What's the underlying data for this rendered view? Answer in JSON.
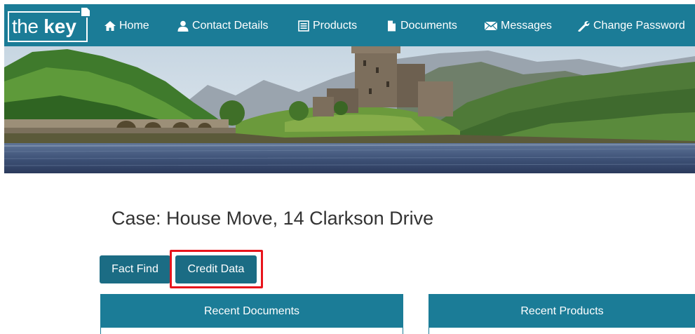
{
  "logo": {
    "word1": "the",
    "word2": "key"
  },
  "nav": {
    "items": [
      {
        "label": "Home",
        "icon": "home-icon"
      },
      {
        "label": "Contact Details",
        "icon": "user-icon"
      },
      {
        "label": "Products",
        "icon": "list-icon"
      },
      {
        "label": "Documents",
        "icon": "file-icon"
      },
      {
        "label": "Messages",
        "icon": "envelope-icon"
      },
      {
        "label": "Change Password",
        "icon": "wrench-icon"
      }
    ]
  },
  "banner": {
    "image": "castle-on-loch-landscape"
  },
  "case": {
    "title": "Case: House Move, 14 Clarkson Drive"
  },
  "tabs": {
    "fact_find": "Fact Find",
    "credit_data": "Credit Data"
  },
  "panels": {
    "recent_documents": "Recent Documents",
    "recent_products": "Recent Products"
  },
  "colors": {
    "brand": "#1b7c97",
    "button": "#1b6c84",
    "highlight": "#e8141c"
  }
}
